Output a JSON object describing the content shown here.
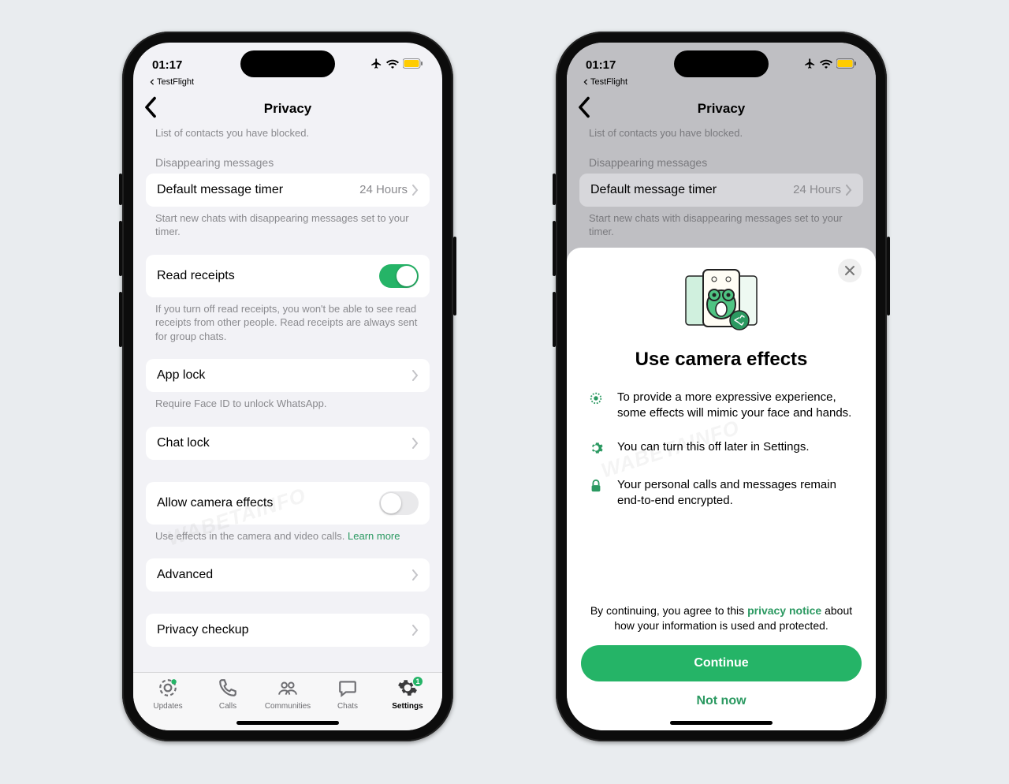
{
  "status": {
    "time": "01:17",
    "breadcrumb": "TestFlight"
  },
  "nav": {
    "title": "Privacy"
  },
  "partial_hint": "List of contacts you have blocked.",
  "disappearing": {
    "header": "Disappearing messages",
    "row_label": "Default message timer",
    "row_value": "24 Hours",
    "footer": "Start new chats with disappearing messages set to your timer."
  },
  "read_receipts": {
    "label": "Read receipts",
    "footer": "If you turn off read receipts, you won't be able to see read receipts from other people. Read receipts are always sent for group chats."
  },
  "app_lock": {
    "label": "App lock",
    "footer": "Require Face ID to unlock WhatsApp."
  },
  "chat_lock": {
    "label": "Chat lock"
  },
  "camera_effects": {
    "label": "Allow camera effects",
    "footer_pre": "Use effects in the camera and video calls. ",
    "footer_link": "Learn more"
  },
  "advanced": {
    "label": "Advanced"
  },
  "checkup": {
    "label": "Privacy checkup"
  },
  "tabs": {
    "updates": "Updates",
    "calls": "Calls",
    "communities": "Communities",
    "chats": "Chats",
    "settings": "Settings",
    "settings_badge": "1"
  },
  "modal": {
    "title": "Use camera effects",
    "bullet1": "To provide a more expressive experience, some effects will mimic your face and hands.",
    "bullet2": "You can turn this off later in Settings.",
    "bullet3": "Your personal calls and messages remain end-to-end encrypted.",
    "legal_pre": "By continuing, you agree to this ",
    "legal_link": "privacy notice",
    "legal_post": " about how your information is used and protected.",
    "continue": "Continue",
    "not_now": "Not now"
  }
}
